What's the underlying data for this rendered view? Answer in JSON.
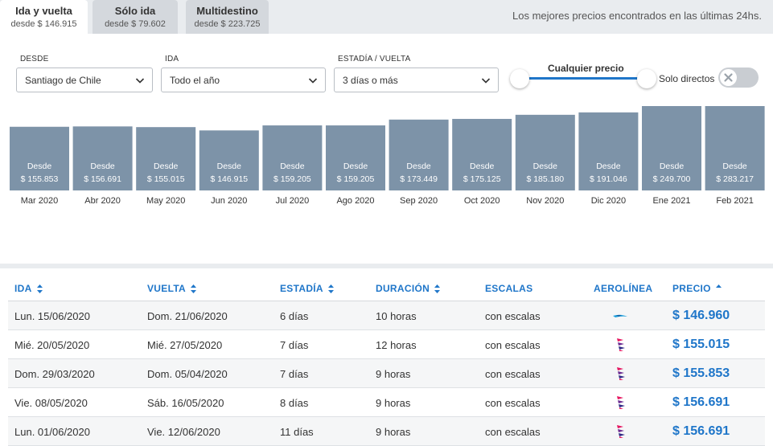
{
  "tabs": [
    {
      "title": "Ida y vuelta",
      "sub": "desde $ 146.915"
    },
    {
      "title": "Sólo ida",
      "sub": "desde $ 79.602"
    },
    {
      "title": "Multidestino",
      "sub": "desde $ 223.725"
    }
  ],
  "tab_note": "Los mejores precios encontrados en las últimas 24hs.",
  "filters": {
    "desde": {
      "label": "DESDE",
      "value": "Santiago de Chile"
    },
    "ida": {
      "label": "IDA",
      "value": "Todo el año"
    },
    "estadia": {
      "label": "ESTADÍA / VUELTA",
      "value": "3 días o más"
    },
    "price_range_label": "Cualquier precio",
    "solo_directos_label": "Solo directos",
    "solo_directos_on": false
  },
  "colors": {
    "bar": "#7d93a8",
    "accent": "#1f76c9"
  },
  "chart_data": {
    "type": "bar",
    "categories": [
      "Mar 2020",
      "Abr 2020",
      "May 2020",
      "Jun 2020",
      "Jul 2020",
      "Ago 2020",
      "Sep 2020",
      "Oct 2020",
      "Nov 2020",
      "Dic 2020",
      "Ene 2021",
      "Feb 2021"
    ],
    "values": [
      155853,
      156691,
      155015,
      146915,
      159205,
      159205,
      173449,
      175125,
      185180,
      191046,
      249700,
      283217
    ],
    "value_labels": [
      "$ 155.853",
      "$ 156.691",
      "$ 155.015",
      "$ 146.915",
      "$ 159.205",
      "$ 159.205",
      "$ 173.449",
      "$ 175.125",
      "$ 185.180",
      "$ 191.046",
      "$ 249.700",
      "$ 283.217"
    ],
    "bar_prefix": "Desde",
    "ylim": [
      0,
      283217
    ],
    "grid": false
  },
  "table": {
    "headers": [
      "IDA",
      "VUELTA",
      "ESTADÍA",
      "DURACIÓN",
      "ESCALAS",
      "AEROLÍNEA",
      "PRECIO"
    ],
    "rows": [
      {
        "ida": "Lun. 15/06/2020",
        "vuelta": "Dom. 21/06/2020",
        "estadia": "6 días",
        "duracion": "10 horas",
        "escalas": "con escalas",
        "airline": "aerolineas-argentinas-icon",
        "price": "$ 146.960"
      },
      {
        "ida": "Mié. 20/05/2020",
        "vuelta": "Mié. 27/05/2020",
        "estadia": "7 días",
        "duracion": "12 horas",
        "escalas": "con escalas",
        "airline": "latam-icon",
        "price": "$ 155.015"
      },
      {
        "ida": "Dom. 29/03/2020",
        "vuelta": "Dom. 05/04/2020",
        "estadia": "7 días",
        "duracion": "9 horas",
        "escalas": "con escalas",
        "airline": "latam-icon",
        "price": "$ 155.853"
      },
      {
        "ida": "Vie. 08/05/2020",
        "vuelta": "Sáb. 16/05/2020",
        "estadia": "8 días",
        "duracion": "9 horas",
        "escalas": "con escalas",
        "airline": "latam-icon",
        "price": "$ 156.691"
      },
      {
        "ida": "Lun. 01/06/2020",
        "vuelta": "Vie. 12/06/2020",
        "estadia": "11 días",
        "duracion": "9 horas",
        "escalas": "con escalas",
        "airline": "latam-icon",
        "price": "$ 156.691"
      }
    ]
  }
}
